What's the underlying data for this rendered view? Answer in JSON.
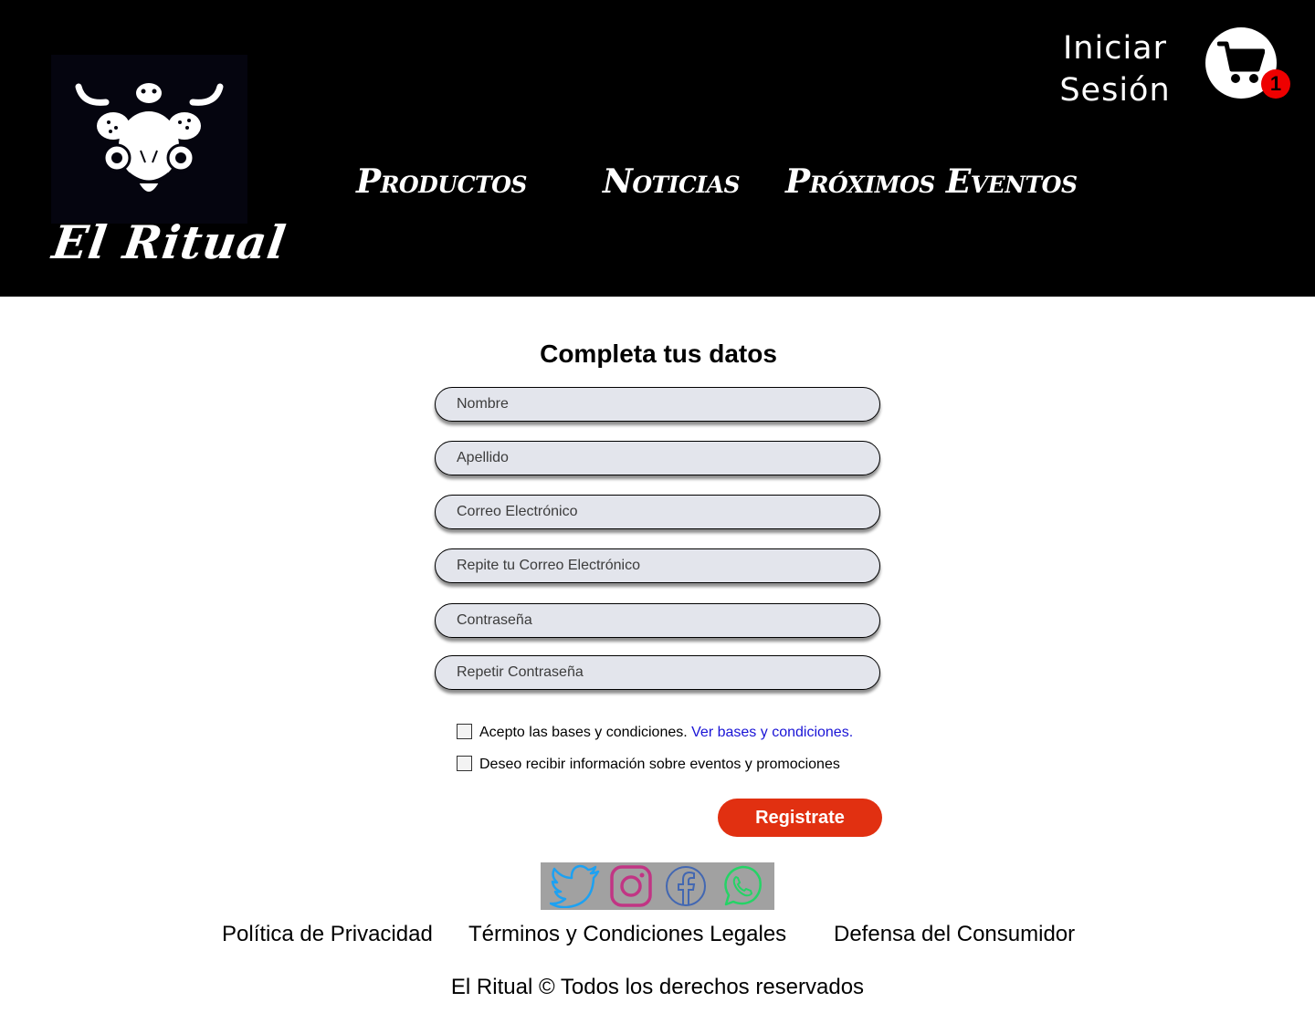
{
  "header": {
    "logo_text": "El Ritual",
    "nav": [
      "Productos",
      "Noticias",
      "Próximos Eventos"
    ],
    "login_label_line1": "Iniciar",
    "login_label_line2": "Sesión",
    "cart_count": "1",
    "cart_icon": "shopping-cart-icon"
  },
  "form": {
    "title": "Completa tus datos",
    "fields": [
      {
        "placeholder": "Nombre"
      },
      {
        "placeholder": "Apellido"
      },
      {
        "placeholder": "Correo Electrónico"
      },
      {
        "placeholder": "Repite tu Correo Electrónico"
      },
      {
        "placeholder": "Contraseña"
      },
      {
        "placeholder": "Repetir Contraseña"
      }
    ],
    "terms_label": "Acepto las bases y condiciones.",
    "terms_link": "Ver bases y condiciones.",
    "newsletter_label": "Deseo recibir información sobre eventos y promociones",
    "submit_label": "Registrate"
  },
  "social": {
    "icons": [
      "twitter-icon",
      "instagram-icon",
      "facebook-icon",
      "whatsapp-icon"
    ],
    "colors": {
      "twitter": "#1da1f2",
      "instagram": "#c13584",
      "facebook": "#4267b2",
      "whatsapp": "#25d366"
    }
  },
  "footer": {
    "links": [
      "Política de Privacidad",
      "Términos y Condiciones Legales",
      "Defensa del Consumidor"
    ],
    "copyright": "El Ritual © Todos los derechos reservados"
  },
  "colors": {
    "header_bg": "#000000",
    "button": "#e13011",
    "badge": "#ee0000",
    "link": "#1a14d6",
    "field_bg": "#e3e5ec"
  }
}
